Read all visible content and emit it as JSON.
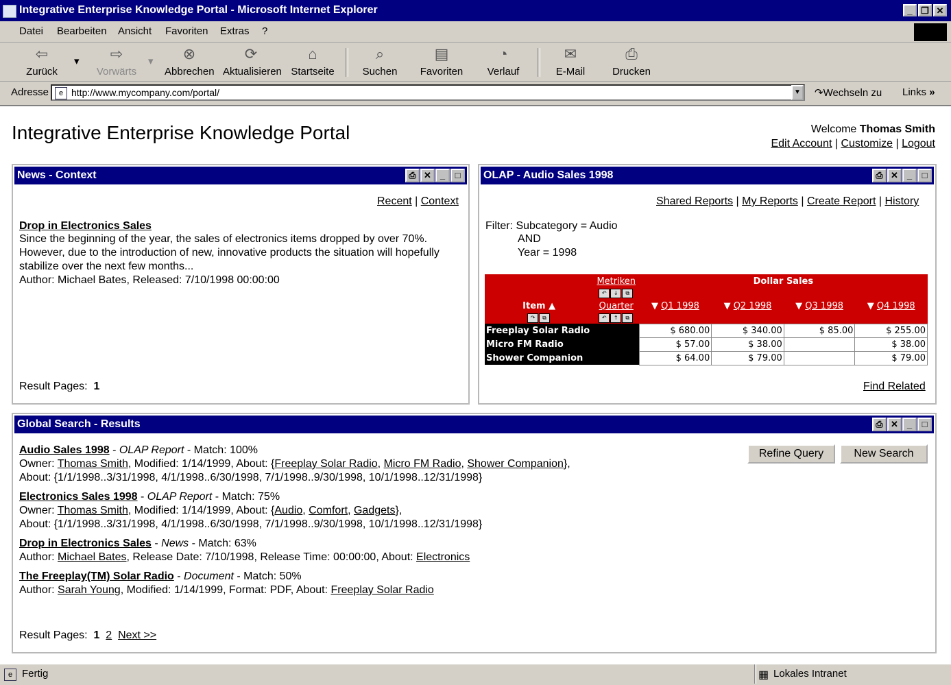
{
  "window": {
    "title": "Integrative Enterprise Knowledge Portal - Microsoft Internet Explorer"
  },
  "menu": [
    "Datei",
    "Bearbeiten",
    "Ansicht",
    "Favoriten",
    "Extras",
    "?"
  ],
  "toolbar": {
    "back": "Zurück",
    "forward": "Vorwärts",
    "stop": "Abbrechen",
    "refresh": "Aktualisieren",
    "home": "Startseite",
    "search": "Suchen",
    "favorites": "Favoriten",
    "history": "Verlauf",
    "mail": "E-Mail",
    "print": "Drucken"
  },
  "address": {
    "label": "Adresse",
    "url": "http://www.mycompany.com/portal/",
    "go": "Wechseln zu",
    "links": "Links"
  },
  "page": {
    "title": "Integrative Enterprise Knowledge Portal",
    "welcome_prefix": "Welcome",
    "user": "Thomas Smith",
    "edit_account": "Edit Account",
    "customize": "Customize",
    "logout": "Logout"
  },
  "news": {
    "title": "News - Context",
    "recent": "Recent",
    "context": "Context",
    "headline": "Drop in Electronics Sales",
    "body1": "Since the beginning of the year, the sales of electronics items dropped by over 70%.",
    "body2": "However, due to the introduction of new, innovative products the situation will hopefully",
    "body3": "stabilize over the next few months...",
    "author": "Author: Michael Bates, Released: 7/10/1998 00:00:00",
    "result_pages_label": "Result Pages:",
    "result_page": "1"
  },
  "olap": {
    "title": "OLAP - Audio Sales 1998",
    "shared_reports": "Shared Reports",
    "my_reports": "My Reports",
    "create_report": "Create Report",
    "history": "History",
    "filter_line1": "Filter: Subcategory = Audio",
    "filter_line2": "AND",
    "filter_line3": "Year = 1998",
    "metriken": "Metriken",
    "measure": "Dollar Sales",
    "item_label": "Item",
    "quarter_label": "Quarter",
    "quarters": [
      "Q1 1998",
      "Q2 1998",
      "Q3 1998",
      "Q4 1998"
    ],
    "rows": [
      {
        "item": "Freeplay Solar Radio",
        "values": [
          "$ 680.00",
          "$ 340.00",
          "$ 85.00",
          "$ 255.00"
        ]
      },
      {
        "item": "Micro FM Radio",
        "values": [
          "$ 57.00",
          "$ 38.00",
          "",
          "$ 38.00"
        ]
      },
      {
        "item": "Shower Companion",
        "values": [
          "$ 64.00",
          "$ 79.00",
          "",
          "$ 79.00"
        ]
      }
    ],
    "find_related": "Find Related"
  },
  "search": {
    "title": "Global Search - Results",
    "refine": "Refine Query",
    "new_search": "New Search",
    "results": [
      {
        "title": "Audio Sales 1998",
        "type": "OLAP Report",
        "match": " - Match: 100%",
        "line2_prefix": "Owner: ",
        "owner": "Thomas Smith",
        "line2_mid": ", Modified: 1/14/1999, About: {",
        "about": [
          "Freeplay Solar Radio",
          "Micro FM Radio",
          "Shower Companion"
        ],
        "line2_end": "},",
        "line3": "About: {1/1/1998..3/31/1998, 4/1/1998..6/30/1998, 7/1/1998..9/30/1998, 10/1/1998..12/31/1998}"
      },
      {
        "title": "Electronics Sales 1998",
        "type": "OLAP Report",
        "match": " - Match: 75%",
        "line2_prefix": "Owner: ",
        "owner": "Thomas Smith",
        "line2_mid": ", Modified: 1/14/1999, About: {",
        "about": [
          "Audio",
          "Comfort",
          "Gadgets"
        ],
        "line2_end": "},",
        "line3": "About: {1/1/1998..3/31/1998, 4/1/1998..6/30/1998, 7/1/1998..9/30/1998, 10/1/1998..12/31/1998}"
      },
      {
        "title": "Drop in Electronics Sales",
        "type": "News",
        "match": " - Match: 63%",
        "line2_prefix": "Author: ",
        "owner": "Michael Bates",
        "line2_mid": ", Release Date: 7/10/1998, Release Time: 00:00:00, About: ",
        "about": [
          "Electronics"
        ]
      },
      {
        "title": "The Freeplay(TM) Solar Radio",
        "type": "Document",
        "match": " - Match: 50%",
        "line2_prefix": "Author: ",
        "owner": "Sarah Young",
        "line2_mid": ", Modified: 1/14/1999, Format: PDF, About: ",
        "about": [
          "Freeplay Solar Radio"
        ]
      }
    ],
    "result_pages_label": "Result Pages:",
    "pages": [
      "1",
      "2"
    ],
    "next": "Next >>"
  },
  "status": {
    "left": "Fertig",
    "zone": "Lokales Intranet"
  }
}
